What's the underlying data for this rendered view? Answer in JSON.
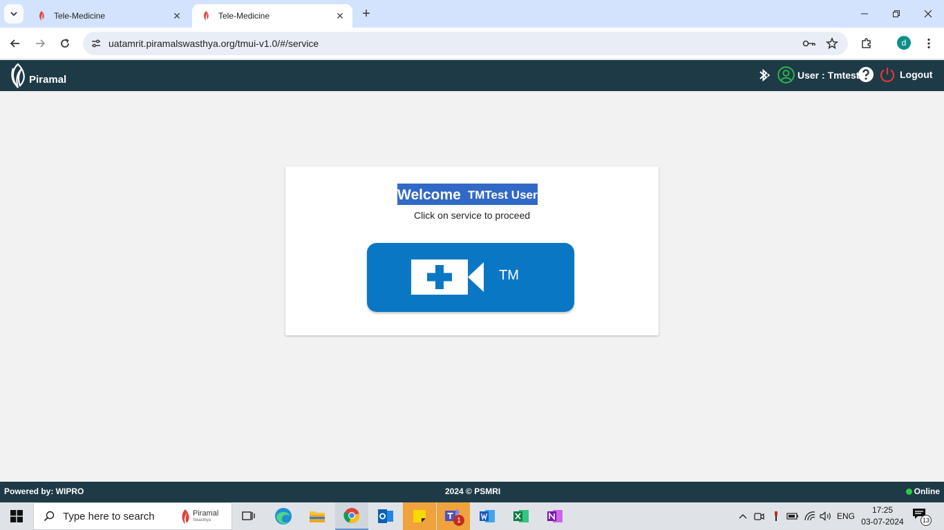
{
  "browser": {
    "tabs": [
      {
        "title": "Tele-Medicine",
        "active": false
      },
      {
        "title": "Tele-Medicine",
        "active": true
      }
    ],
    "url": "uatamrit.piramalswasthya.org/tmui-v1.0/#/service",
    "profile_initial": "d"
  },
  "app": {
    "logo_text": "Piramal",
    "user_label": "User : Tmtest",
    "logout_label": "Logout"
  },
  "main": {
    "welcome_word": "Welcome",
    "user_name": "TMTest User",
    "subtitle": "Click on service to proceed",
    "service_label": "TM"
  },
  "footer": {
    "powered_by": "Powered by: WIPRO",
    "copyright": "2024 © PSMRI",
    "status": "Online"
  },
  "taskbar": {
    "search_placeholder": "Type here to search",
    "search_brand": "Piramal",
    "search_brand_sub": "Swasthya",
    "language": "ENG",
    "time": "17:25",
    "date": "03-07-2024",
    "notification_count": "13",
    "teams_badge": "1"
  },
  "colors": {
    "header_bg": "#1f3a47",
    "service_blue": "#0a77c5",
    "selection_blue": "#3169c6",
    "online_green": "#2ecc40"
  }
}
